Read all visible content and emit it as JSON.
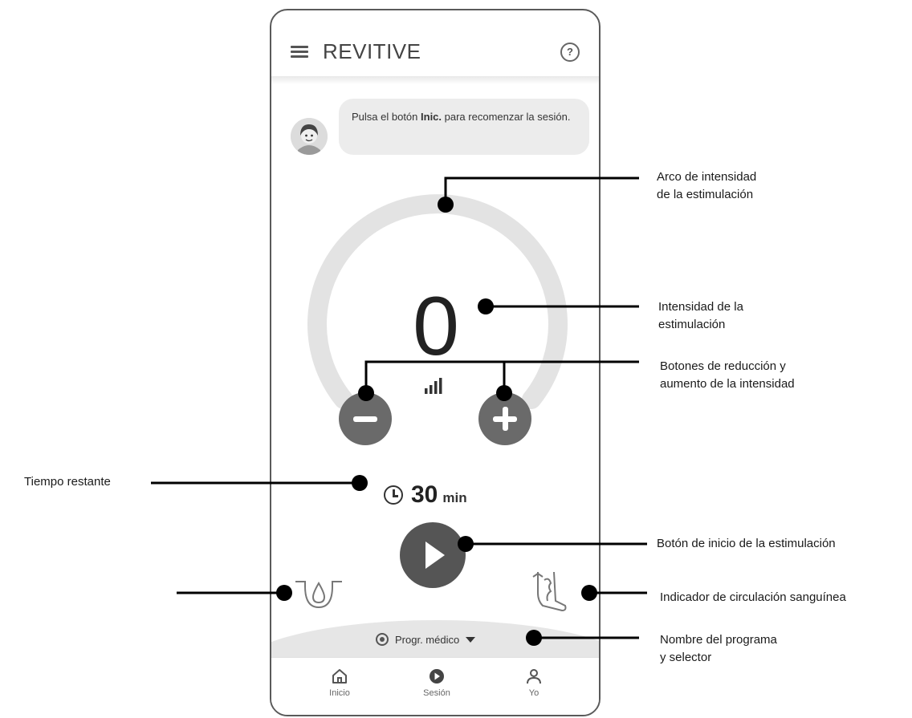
{
  "header": {
    "title": "REVITIVE"
  },
  "message": {
    "text_before": "Pulsa el botón ",
    "text_bold": "Inic.",
    "text_after": " para recomenzar la sesión."
  },
  "intensity": {
    "value": "0"
  },
  "timer": {
    "value": "30",
    "unit": "min"
  },
  "program": {
    "label": "Progr. médico"
  },
  "nav": {
    "items": [
      {
        "label": "Inicio"
      },
      {
        "label": "Sesión"
      },
      {
        "label": "Yo"
      }
    ]
  },
  "annotations": {
    "arc": [
      "Arco de intensidad",
      "de la estimulación"
    ],
    "intensity": [
      "Intensidad de la",
      "estimulación"
    ],
    "buttons": [
      "Botones de reducción y",
      "aumento de la intensidad"
    ],
    "time": "Tiempo restante",
    "start": "Botón de inicio de la estimulación",
    "circulation": "Indicador de circulación sanguínea",
    "program": [
      "Nombre del programa",
      "y selector"
    ]
  },
  "colors": {
    "button": "#6a6a6a",
    "play": "#555555",
    "arc": "#e3e3e3",
    "annotation_line": "#000000"
  }
}
